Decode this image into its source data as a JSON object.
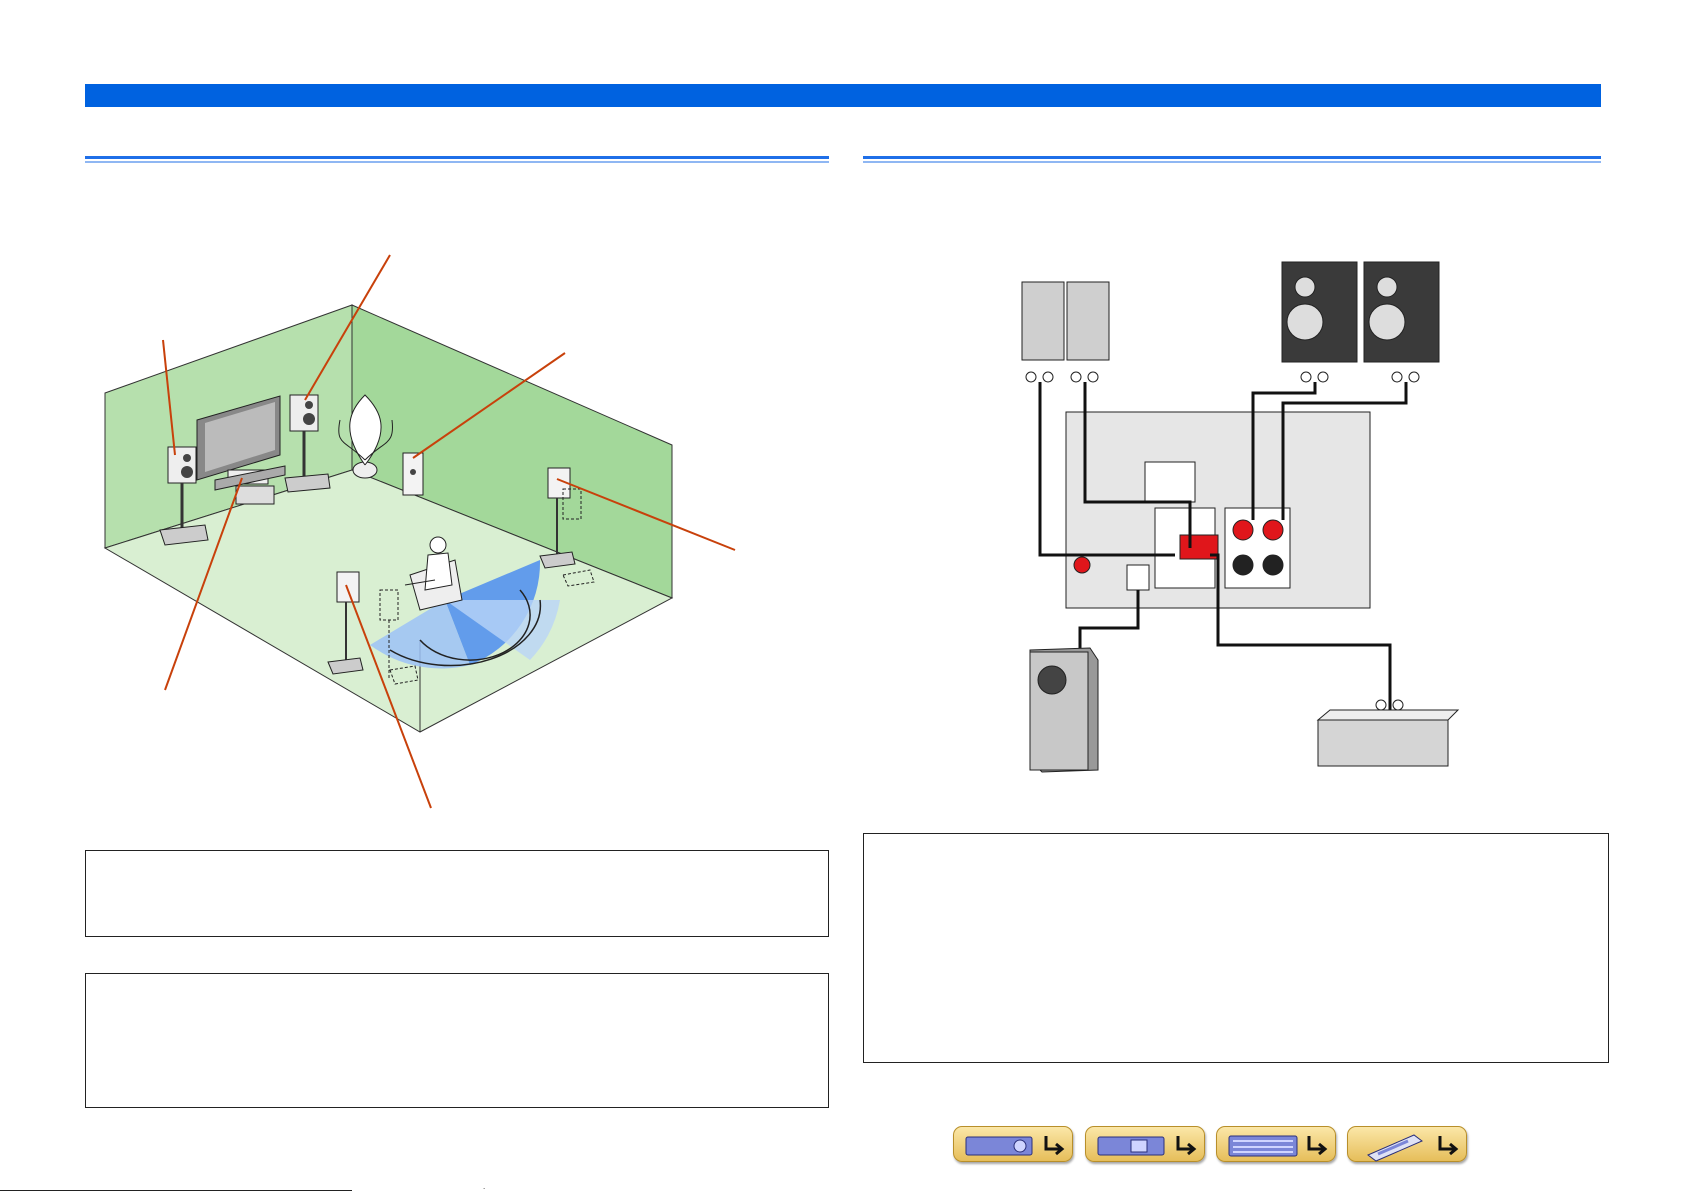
{
  "header": {
    "bar_color": "#0062e0"
  },
  "sections": {
    "left_rule_color": "#1f6fe8",
    "right_rule_color": "#1f6fe8"
  },
  "figures": {
    "room_layout": {
      "wall_color": "#a9dca3",
      "listening_arc_color": "#4c8df0"
    },
    "connection_diagram": {
      "terminal_color": "#e0161b"
    }
  },
  "nav_buttons": [
    {
      "icon": "front-panel-icon"
    },
    {
      "icon": "rear-panel-icon"
    },
    {
      "icon": "display-icon"
    },
    {
      "icon": "remote-control-icon"
    }
  ],
  "footer": {
    "page_mark": "."
  }
}
